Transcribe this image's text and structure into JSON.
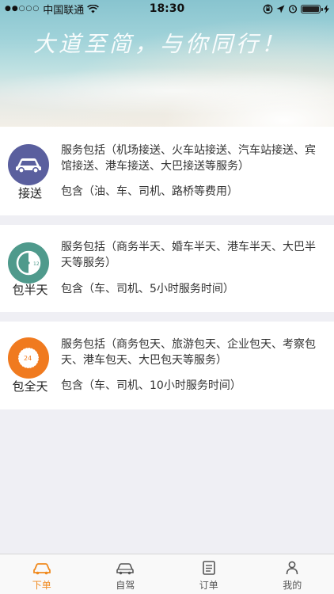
{
  "status_bar": {
    "carrier": "中国联通",
    "time": "18:30"
  },
  "banner": {
    "slogan": "大道至简，与你同行！"
  },
  "services": [
    {
      "name": "接送",
      "icon": "car-icon",
      "color": "#5a5f9e",
      "description": "服务包括（机场接送、火车站接送、汽车站接送、宾馆接送、港车接送、大巴接送等服务）",
      "includes": "包含（油、车、司机、路桥等费用）"
    },
    {
      "name": "包半天",
      "icon": "half-day-clock-icon",
      "color": "#4f9a8c",
      "description": "服务包括（商务半天、婚车半天、港车半天、大巴半天等服务）",
      "includes": "包含（车、司机、5小时服务时间）"
    },
    {
      "name": "包全天",
      "icon": "full-day-clock-icon",
      "color": "#f07a1f",
      "description": "服务包括（商务包天、旅游包天、企业包天、考察包天、港车包天、大巴包天等服务）",
      "includes": "包含（车、司机、10小时服务时间）"
    }
  ],
  "tabs": [
    {
      "label": "下单",
      "icon": "order-car-icon",
      "active": true
    },
    {
      "label": "自驾",
      "icon": "self-drive-car-icon",
      "active": false
    },
    {
      "label": "订单",
      "icon": "order-list-icon",
      "active": false
    },
    {
      "label": "我的",
      "icon": "profile-icon",
      "active": false
    }
  ],
  "colors": {
    "accent": "#f08a1f",
    "background": "#efeff4"
  }
}
